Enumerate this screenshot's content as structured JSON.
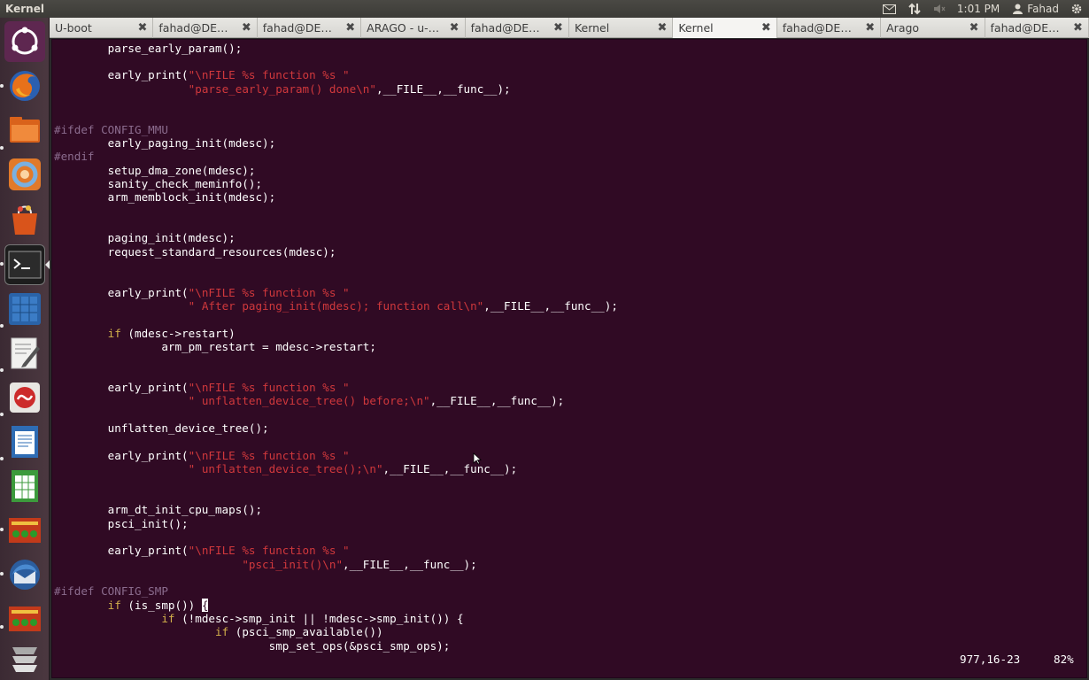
{
  "panel": {
    "title": "Kernel",
    "time": "1:01 PM",
    "user": "Fahad",
    "icons": [
      "mail-icon",
      "network-icon",
      "volume-muted-icon",
      "user-icon",
      "gear-icon"
    ]
  },
  "launcher": {
    "items": [
      "ubuntu-dash-icon",
      "firefox-icon",
      "files-icon",
      "sphere-app-icon",
      "software-center-icon",
      "terminal-icon",
      "calculator-icon",
      "text-editor-icon",
      "pdf-viewer-icon",
      "writer-icon",
      "calc-spreadsheet-icon",
      "network-board-icon",
      "thunderbird-icon",
      "network-board-2-icon",
      "workspaces-icon"
    ]
  },
  "tabs": [
    {
      "label": "U-boot",
      "active": false
    },
    {
      "label": "fahad@DEX...",
      "active": false
    },
    {
      "label": "fahad@DEX...",
      "active": false
    },
    {
      "label": "ARAGO - u-b...",
      "active": false
    },
    {
      "label": "fahad@DEX...",
      "active": false
    },
    {
      "label": "Kernel",
      "active": false
    },
    {
      "label": "Kernel",
      "active": true
    },
    {
      "label": "fahad@DEX...",
      "active": false
    },
    {
      "label": "Arago",
      "active": false
    },
    {
      "label": "fahad@DEX...",
      "active": false
    }
  ],
  "code_lines": [
    [
      {
        "t": "        parse_early_param();",
        "c": ""
      }
    ],
    [
      {
        "t": "",
        "c": ""
      }
    ],
    [
      {
        "t": "        early_print(",
        "c": ""
      },
      {
        "t": "\"\\nFILE %s function %s \"",
        "c": "str"
      }
    ],
    [
      {
        "t": "                    ",
        "c": ""
      },
      {
        "t": "\"parse_early_param() done\\n\"",
        "c": "str"
      },
      {
        "t": ",__FILE__,__func__);",
        "c": ""
      }
    ],
    [
      {
        "t": "",
        "c": ""
      }
    ],
    [
      {
        "t": "",
        "c": ""
      }
    ],
    [
      {
        "t": "#ifdef CONFIG_MMU",
        "c": "pp"
      }
    ],
    [
      {
        "t": "        early_paging_init(mdesc);",
        "c": ""
      }
    ],
    [
      {
        "t": "#endif",
        "c": "pp"
      }
    ],
    [
      {
        "t": "        setup_dma_zone(mdesc);",
        "c": ""
      }
    ],
    [
      {
        "t": "        sanity_check_meminfo();",
        "c": ""
      }
    ],
    [
      {
        "t": "        arm_memblock_init(mdesc);",
        "c": ""
      }
    ],
    [
      {
        "t": "",
        "c": ""
      }
    ],
    [
      {
        "t": "",
        "c": ""
      }
    ],
    [
      {
        "t": "        paging_init(mdesc);",
        "c": ""
      }
    ],
    [
      {
        "t": "        request_standard_resources(mdesc);",
        "c": ""
      }
    ],
    [
      {
        "t": "",
        "c": ""
      }
    ],
    [
      {
        "t": "",
        "c": ""
      }
    ],
    [
      {
        "t": "        early_print(",
        "c": ""
      },
      {
        "t": "\"\\nFILE %s function %s \"",
        "c": "str"
      }
    ],
    [
      {
        "t": "                    ",
        "c": ""
      },
      {
        "t": "\" After paging_init(mdesc); function call\\n\"",
        "c": "str"
      },
      {
        "t": ",__FILE__,__func__);",
        "c": ""
      }
    ],
    [
      {
        "t": "",
        "c": ""
      }
    ],
    [
      {
        "t": "        ",
        "c": ""
      },
      {
        "t": "if",
        "c": "kw"
      },
      {
        "t": " (mdesc->restart)",
        "c": ""
      }
    ],
    [
      {
        "t": "                arm_pm_restart = mdesc->restart;",
        "c": ""
      }
    ],
    [
      {
        "t": "",
        "c": ""
      }
    ],
    [
      {
        "t": "",
        "c": ""
      }
    ],
    [
      {
        "t": "        early_print(",
        "c": ""
      },
      {
        "t": "\"\\nFILE %s function %s \"",
        "c": "str"
      }
    ],
    [
      {
        "t": "                    ",
        "c": ""
      },
      {
        "t": "\" unflatten_device_tree() before;\\n\"",
        "c": "str"
      },
      {
        "t": ",__FILE__,__func__);",
        "c": ""
      }
    ],
    [
      {
        "t": "",
        "c": ""
      }
    ],
    [
      {
        "t": "        unflatten_device_tree();",
        "c": ""
      }
    ],
    [
      {
        "t": "",
        "c": ""
      }
    ],
    [
      {
        "t": "        early_print(",
        "c": ""
      },
      {
        "t": "\"\\nFILE %s function %s \"",
        "c": "str"
      }
    ],
    [
      {
        "t": "                    ",
        "c": ""
      },
      {
        "t": "\" unflatten_device_tree();\\n\"",
        "c": "str"
      },
      {
        "t": ",__FILE__,__func__);",
        "c": ""
      }
    ],
    [
      {
        "t": "",
        "c": ""
      }
    ],
    [
      {
        "t": "",
        "c": ""
      }
    ],
    [
      {
        "t": "        arm_dt_init_cpu_maps();",
        "c": ""
      }
    ],
    [
      {
        "t": "        psci_init();",
        "c": ""
      }
    ],
    [
      {
        "t": "",
        "c": ""
      }
    ],
    [
      {
        "t": "        early_print(",
        "c": ""
      },
      {
        "t": "\"\\nFILE %s function %s \"",
        "c": "str"
      }
    ],
    [
      {
        "t": "                            ",
        "c": ""
      },
      {
        "t": "\"psci_init()\\n\"",
        "c": "str"
      },
      {
        "t": ",__FILE__,__func__);",
        "c": ""
      }
    ],
    [
      {
        "t": "",
        "c": ""
      }
    ],
    [
      {
        "t": "#ifdef CONFIG_SMP",
        "c": "pp"
      }
    ],
    [
      {
        "t": "        ",
        "c": ""
      },
      {
        "t": "if",
        "c": "kw"
      },
      {
        "t": " (is_smp()) ",
        "c": ""
      },
      {
        "t": "{",
        "c": "cursor"
      }
    ],
    [
      {
        "t": "                ",
        "c": ""
      },
      {
        "t": "if",
        "c": "kw"
      },
      {
        "t": " (!mdesc->smp_init || !mdesc->smp_init()) {",
        "c": ""
      }
    ],
    [
      {
        "t": "                        ",
        "c": ""
      },
      {
        "t": "if",
        "c": "kw"
      },
      {
        "t": " (psci_smp_available())",
        "c": ""
      }
    ],
    [
      {
        "t": "                                smp_set_ops(&psci_smp_ops);",
        "c": ""
      }
    ]
  ],
  "status": {
    "position": "977,16-23",
    "percent": "82%"
  }
}
